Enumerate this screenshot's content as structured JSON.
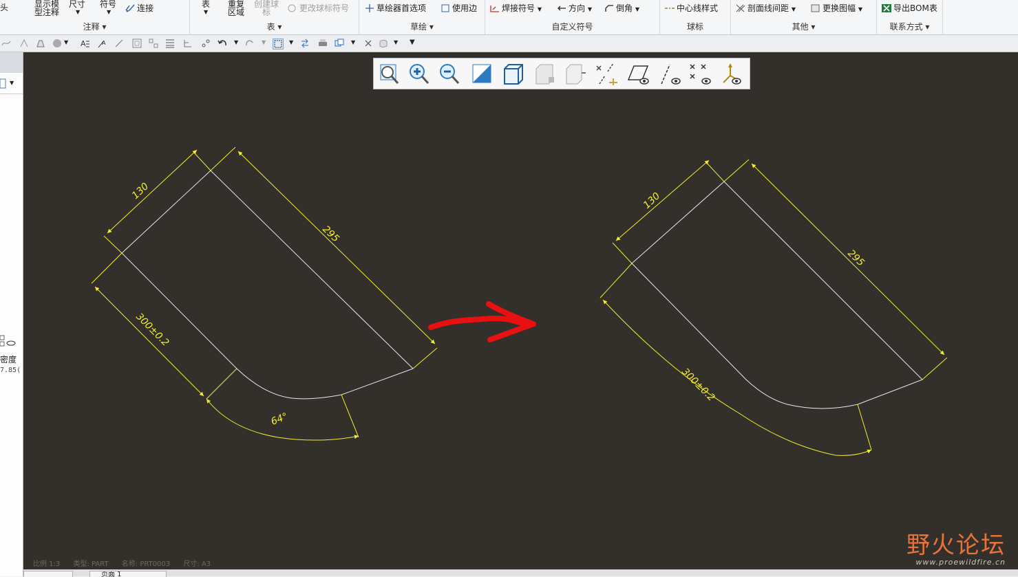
{
  "ribbon": {
    "groups": [
      {
        "label": "注释",
        "items": {
          "show_annot_1": "显示模",
          "show_annot_2": "型注释",
          "dimension": "尺寸",
          "symbol": "符号",
          "connect": "连接",
          "head_fragment": "头"
        }
      },
      {
        "label": "表",
        "items": {
          "table": "表",
          "repeat_1": "重复",
          "repeat_2": "区域",
          "create_balloon_1": "创建球",
          "create_balloon_2": "标",
          "change_balloon": "更改球标符号"
        }
      },
      {
        "label": "草绘",
        "items": {
          "sketch_prefs": "草绘器首选项",
          "use_edge": "使用边"
        }
      },
      {
        "label": "自定义符号",
        "items": {
          "weld": "焊接符号",
          "direction": "方向",
          "chamfer": "倒角"
        }
      },
      {
        "label": "球标",
        "items": {
          "centerline": "中心线样式"
        }
      },
      {
        "label": "其他",
        "items": {
          "hatch_spacing": "剖面线间距",
          "replace_sheet": "更换图幅"
        }
      },
      {
        "label": "联系方式",
        "items": {
          "export_bom": "导出BOM表"
        }
      }
    ]
  },
  "left_panel": {
    "density_label": "密度",
    "density_value": "7.85("
  },
  "view_toolbar": {
    "icons": [
      "zoom-fit-icon",
      "zoom-in-icon",
      "zoom-out-icon",
      "repaint-icon",
      "shaded-view-icon",
      "display-style-icon",
      "next-view-icon",
      "datum-axis-icon",
      "datum-plane-icon",
      "axis-display-icon",
      "point-display-icon",
      "csys-display-icon"
    ]
  },
  "drawing": {
    "before": {
      "dim_width": "130",
      "dim_length": "295",
      "dim_bottom": "300±0.2",
      "dim_angle": "64°"
    },
    "after": {
      "dim_width": "130",
      "dim_length": "295",
      "dim_bottom": "300±0.2"
    }
  },
  "status": {
    "scale": "比例 1:3",
    "type": "类型: PART",
    "name": "名称: PRT0003",
    "size": "尺寸: A3"
  },
  "watermark": {
    "main": "野火论坛",
    "url": "www.proewildfire.cn"
  },
  "bottom_tab": "页面 1",
  "colors": {
    "canvas": "#33302c",
    "dimension": "#f2ee2a",
    "geometry": "#e8e8e8",
    "arrow": "#e81010",
    "watermark": "#e8733a"
  }
}
